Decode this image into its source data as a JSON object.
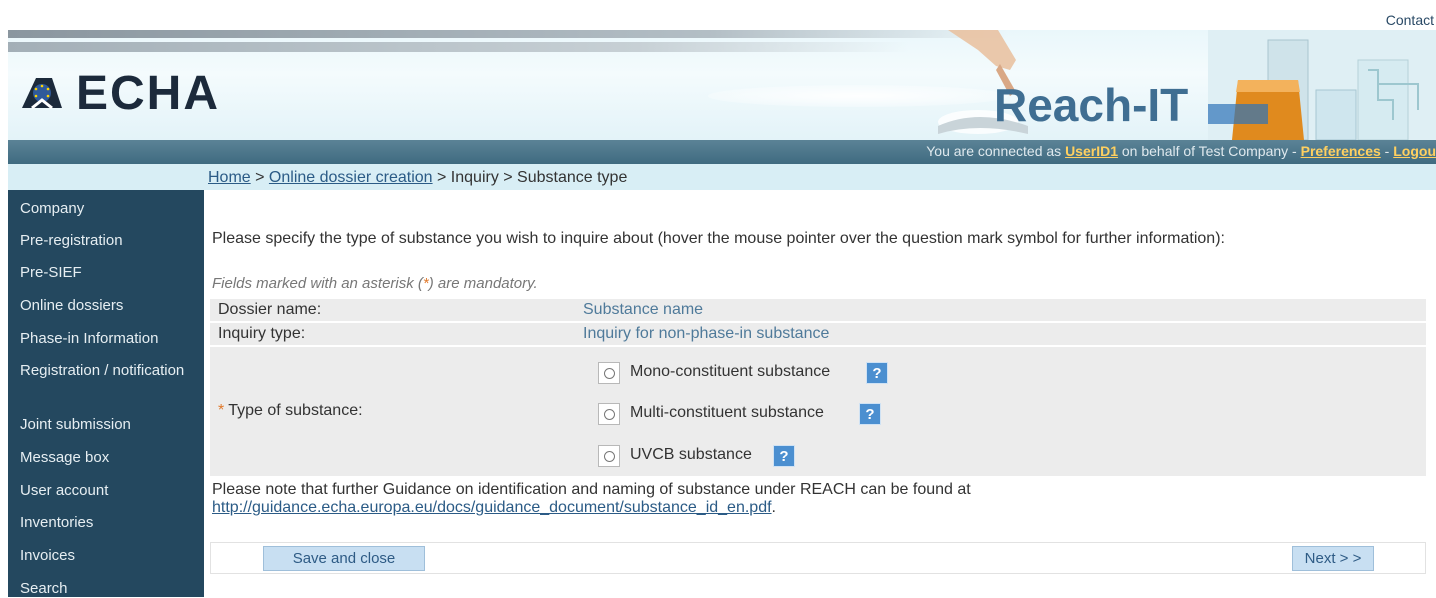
{
  "header": {
    "contact_label": "Contact",
    "logo_text": "ECHA",
    "app_name": "Reach-IT"
  },
  "status": {
    "prefix": "You are connected as ",
    "user": "UserID1",
    "middle": " on behalf of Test Company - ",
    "preferences": "Preferences",
    "sep": " - ",
    "logout": "Logou"
  },
  "breadcrumb": {
    "home": "Home",
    "sep1": " > ",
    "online": "Online dossier creation",
    "rest": " > Inquiry > Substance type"
  },
  "sidebar": {
    "items": [
      {
        "label": "Company"
      },
      {
        "label": "Pre-registration"
      },
      {
        "label": "Pre-SIEF"
      },
      {
        "label": "Online dossiers"
      },
      {
        "label": "Phase-in Information"
      },
      {
        "label": "Registration / notification"
      },
      {
        "label": "Joint submission"
      },
      {
        "label": "Message box"
      },
      {
        "label": "User account"
      },
      {
        "label": "Inventories"
      },
      {
        "label": "Invoices"
      },
      {
        "label": "Search"
      }
    ]
  },
  "main": {
    "intro": "Please specify the type of substance you wish to inquire about (hover the mouse pointer over the question mark symbol for further information):",
    "mandatory_before": "Fields marked with an asterisk (",
    "asterisk": "*",
    "mandatory_after": ") are mandatory.",
    "dossier_label": "Dossier name:",
    "dossier_value": "Substance name",
    "inquiry_label": "Inquiry type:",
    "inquiry_value": "Inquiry for non-phase-in substance",
    "type_label": "Type of substance:",
    "options": [
      {
        "label": "Mono-constituent substance",
        "help": "?"
      },
      {
        "label": "Multi-constituent substance",
        "help": "?"
      },
      {
        "label": "UVCB substance",
        "help": "?"
      }
    ],
    "note_text": "Please note that further Guidance on identification and naming of substance under REACH can be found at",
    "note_link": "http://guidance.echa.europa.eu/docs/guidance_document/substance_id_en.pdf",
    "note_end": "."
  },
  "buttons": {
    "save_close": "Save and close",
    "next": "Next > >"
  },
  "colors": {
    "sidebar_bg": "#24485f",
    "status_bar": "#4a7488",
    "crumb_bg": "#d8eef5",
    "link": "#2b5b86",
    "highlight_link": "#ffd060",
    "asterisk": "#e0792b",
    "help_icon": "#4b8fd0",
    "button_bg": "#c8dff2"
  }
}
